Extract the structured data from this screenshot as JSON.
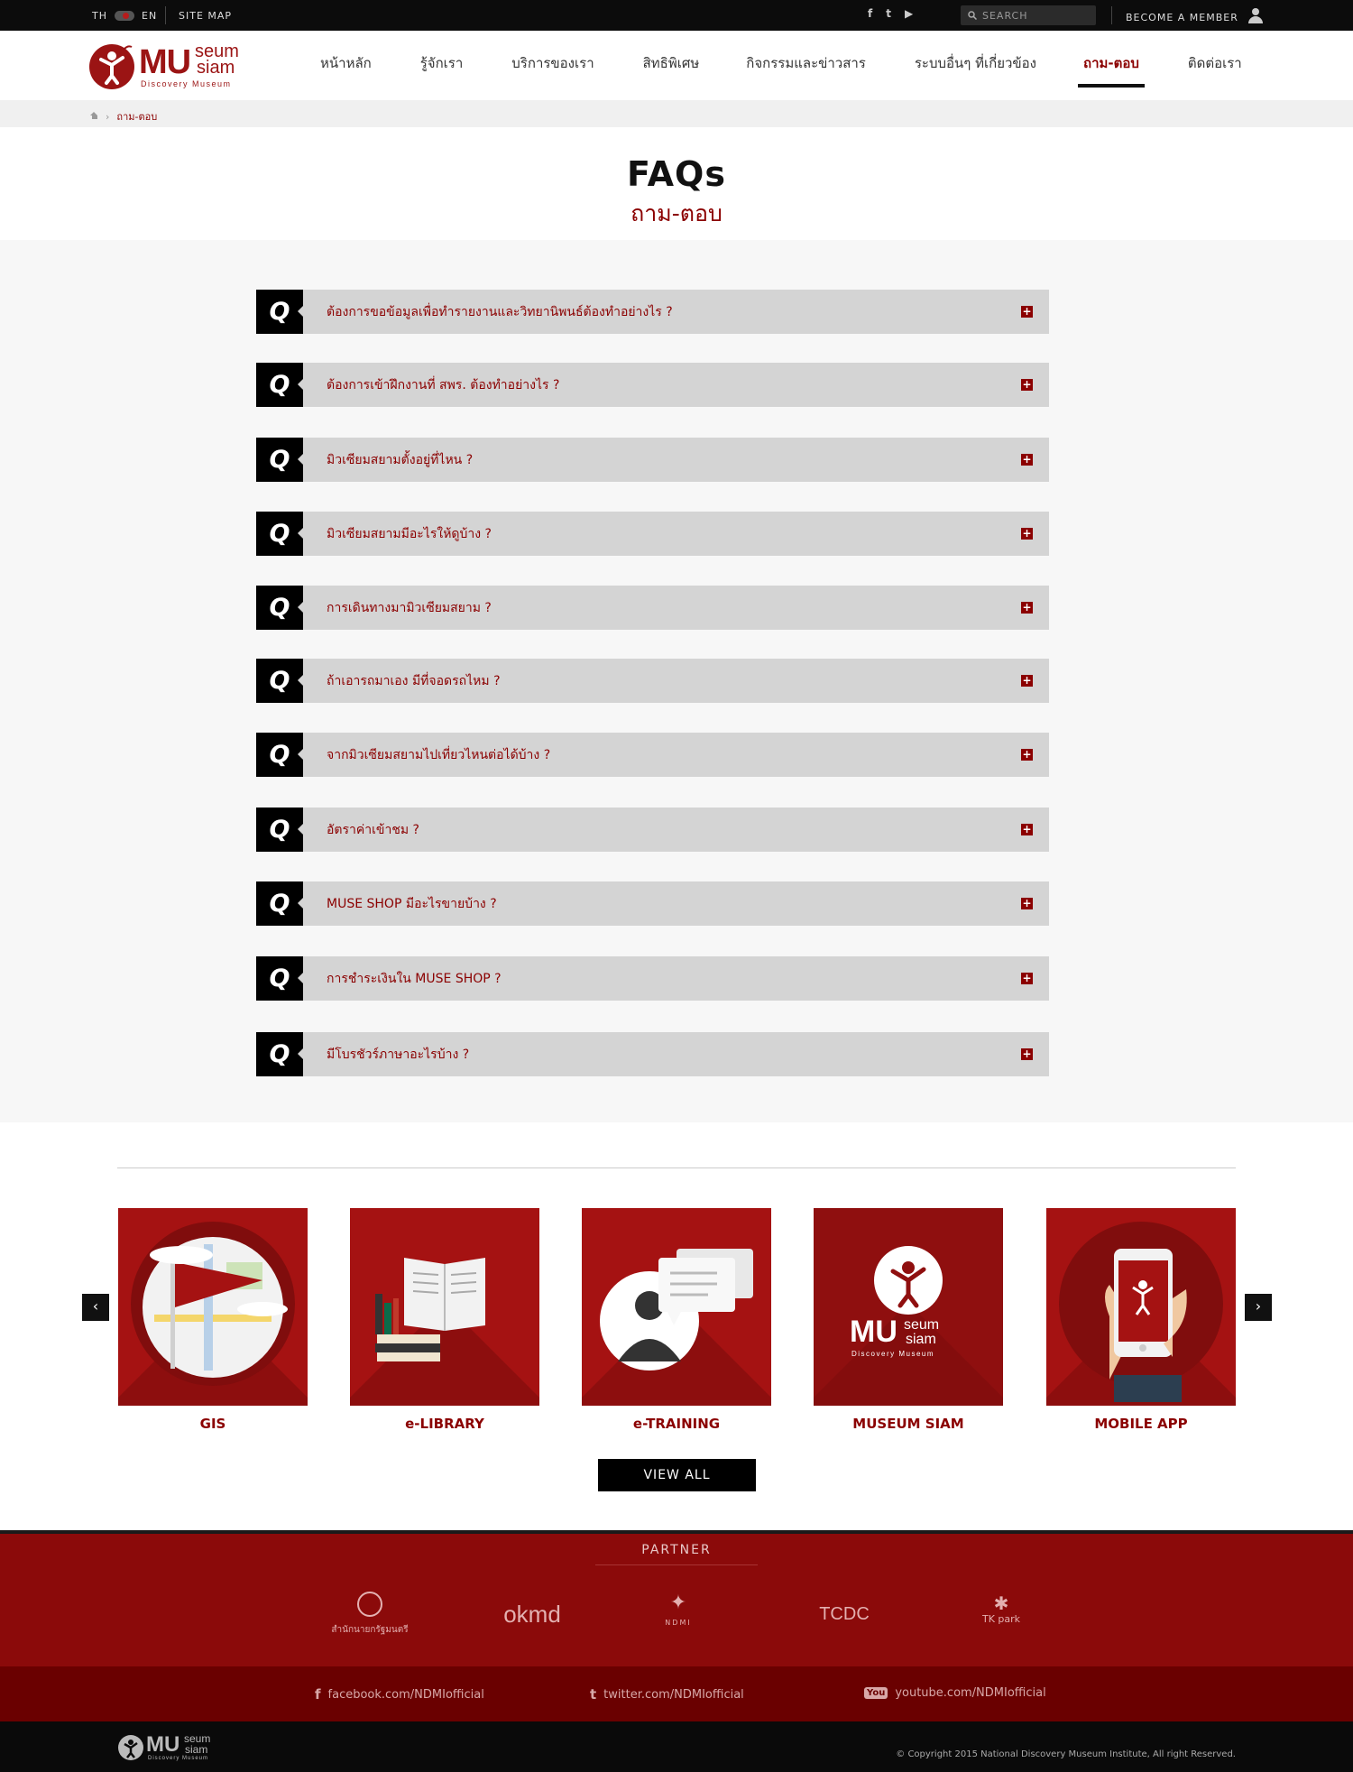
{
  "topbar": {
    "lang_th": "TH",
    "lang_en": "EN",
    "site_map": "SITE MAP",
    "social": [
      {
        "icon": "facebook-icon",
        "glyph": "f"
      },
      {
        "icon": "twitter-icon",
        "glyph": "t"
      },
      {
        "icon": "youtube-icon",
        "glyph": "▶"
      }
    ],
    "search_placeholder": "SEARCH",
    "become_member": "BECOME A MEMBER"
  },
  "logo": {
    "main": "MU",
    "top": "seum",
    "bottom": "siam",
    "tagline": "Discovery Museum"
  },
  "nav": [
    {
      "label": "หน้าหลัก",
      "active": false
    },
    {
      "label": "รู้จักเรา",
      "active": false
    },
    {
      "label": "บริการของเรา",
      "active": false
    },
    {
      "label": "สิทธิพิเศษ",
      "active": false
    },
    {
      "label": "กิจกรรมและข่าวสาร",
      "active": false
    },
    {
      "label": "ระบบอื่นๆ ที่เกี่ยวข้อง",
      "active": false
    },
    {
      "label": "ถาม-ตอบ",
      "active": true
    },
    {
      "label": "ติดต่อเรา",
      "active": false
    }
  ],
  "breadcrumb": {
    "current": "ถาม-ตอบ"
  },
  "page": {
    "title": "FAQs",
    "subtitle": "ถาม-ตอบ"
  },
  "faqs": [
    {
      "q": "Q",
      "text": "ต้องการขอข้อมูลเพื่อทำรายงานและวิทยานิพนธ์ต้องทำอย่างไร ?"
    },
    {
      "q": "Q",
      "text": "ต้องการเข้าฝึกงานที่ สพร. ต้องทำอย่างไร ?"
    },
    {
      "q": "Q",
      "text": "มิวเซียมสยามตั้งอยู่ที่ไหน ?"
    },
    {
      "q": "Q",
      "text": "มิวเซียมสยามมีอะไรให้ดูบ้าง ?"
    },
    {
      "q": "Q",
      "text": "การเดินทางมามิวเซียมสยาม ?"
    },
    {
      "q": "Q",
      "text": "ถ้าเอารถมาเอง มีที่จอดรถไหม ?"
    },
    {
      "q": "Q",
      "text": "จากมิวเซียมสยามไปเที่ยวไหนต่อได้บ้าง ?"
    },
    {
      "q": "Q",
      "text": "อัตราค่าเข้าชม ?"
    },
    {
      "q": "Q",
      "text": "MUSE SHOP มีอะไรขายบ้าง ?"
    },
    {
      "q": "Q",
      "text": "การชำระเงินใน MUSE SHOP ?"
    },
    {
      "q": "Q",
      "text": "มีโบรชัวร์ภาษาอะไรบ้าง ?"
    }
  ],
  "faq_expand_glyph": "+",
  "carousel": {
    "prev": "‹",
    "next": "›",
    "items": [
      {
        "label": "GIS",
        "icon": "map-flag-icon"
      },
      {
        "label": "e-LIBRARY",
        "icon": "books-icon"
      },
      {
        "label": "e-TRAINING",
        "icon": "chat-person-icon"
      },
      {
        "label": "MUSEUM SIAM",
        "icon": "museum-siam-logo-icon"
      },
      {
        "label": "MOBILE APP",
        "icon": "mobile-phone-icon"
      }
    ],
    "view_all": "VIEW ALL"
  },
  "partner": {
    "title": "PARTNER",
    "logos": [
      {
        "label": "สำนักนายกรัฐมนตรี",
        "name": "office-pm-logo"
      },
      {
        "label": "okmd",
        "name": "okmd-logo"
      },
      {
        "label": "NDMI",
        "name": "ndmi-logo"
      },
      {
        "label": "TCDC",
        "name": "tcdc-logo"
      },
      {
        "label": "TK park",
        "name": "tkpark-logo"
      }
    ]
  },
  "social_links": [
    {
      "glyph": "f",
      "text": "facebook.com/NDMIofficial"
    },
    {
      "glyph": "t",
      "text": "twitter.com/NDMIofficial"
    },
    {
      "glyph": "You",
      "text": "youtube.com/NDMIofficial"
    }
  ],
  "footer": {
    "copyright": "© Copyright 2015 National Discovery Museum Institute, All right Reserved."
  },
  "colors": {
    "brand_red": "#8b0000",
    "tile_red": "#a51212",
    "topbar": "#0c0c0c"
  }
}
